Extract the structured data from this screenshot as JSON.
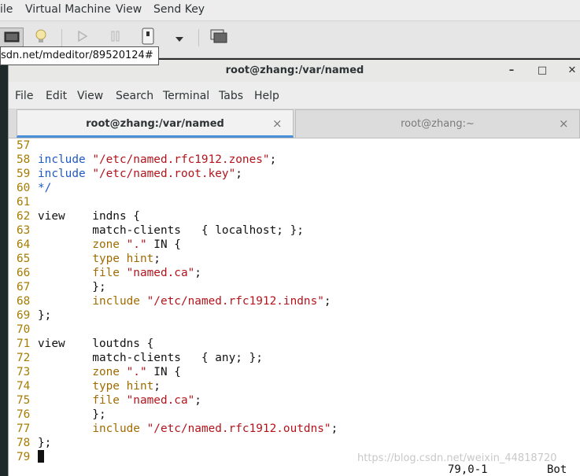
{
  "vm_menu": [
    "ile",
    "Virtual Machine",
    "View",
    "Send Key"
  ],
  "toolbar_icons": [
    "console-icon",
    "lightbulb-icon",
    "play-icon",
    "pause-icon",
    "power-icon",
    "dropdown-arrow-icon",
    "screenshot-icon"
  ],
  "tooltip_url": "sdn.net/mdeditor/89520124#",
  "window": {
    "title": "root@zhang:/var/named",
    "minimize": "–",
    "maximize": "□",
    "close": "✕"
  },
  "terminal_menu": [
    "File",
    "Edit",
    "View",
    "Search",
    "Terminal",
    "Tabs",
    "Help"
  ],
  "tabs": [
    {
      "label": "root@zhang:/var/named",
      "close": "×"
    },
    {
      "label": "root@zhang:~",
      "close": "×"
    }
  ],
  "code_lines": [
    {
      "n": "57",
      "parts": []
    },
    {
      "n": "58",
      "parts": [
        [
          "kw",
          "include "
        ],
        [
          "st",
          "\"/etc/named.rfc1912.zones\""
        ],
        [
          "",
          ""
        ],
        [
          "",
          ";"
        ]
      ]
    },
    {
      "n": "59",
      "parts": [
        [
          "kw",
          "include "
        ],
        [
          "st",
          "\"/etc/named.root.key\""
        ],
        [
          "",
          ";"
        ]
      ]
    },
    {
      "n": "60",
      "parts": [
        [
          "cm",
          "*/"
        ]
      ]
    },
    {
      "n": "61",
      "parts": []
    },
    {
      "n": "62",
      "parts": [
        [
          "",
          "view    indns {"
        ]
      ]
    },
    {
      "n": "63",
      "parts": [
        [
          "",
          "        match-clients   { localhost; };"
        ]
      ]
    },
    {
      "n": "64",
      "parts": [
        [
          "",
          "        "
        ],
        [
          "ty",
          "zone"
        ],
        [
          "",
          ""
        ],
        [
          "st",
          " \".\""
        ],
        [
          "",
          " IN {"
        ]
      ]
    },
    {
      "n": "65",
      "parts": [
        [
          "",
          "        "
        ],
        [
          "ty",
          "type"
        ],
        [
          "",
          ""
        ],
        [
          "ty",
          " hint"
        ],
        [
          "",
          ";"
        ]
      ]
    },
    {
      "n": "66",
      "parts": [
        [
          "",
          "        "
        ],
        [
          "ty",
          "file"
        ],
        [
          "st",
          " \"named.ca\""
        ],
        [
          "",
          ";"
        ]
      ]
    },
    {
      "n": "67",
      "parts": [
        [
          "",
          "        };"
        ]
      ]
    },
    {
      "n": "68",
      "parts": [
        [
          "",
          "        "
        ],
        [
          "ty",
          "include"
        ],
        [
          "st",
          " \"/etc/named.rfc1912.indns\""
        ],
        [
          "",
          ";"
        ]
      ]
    },
    {
      "n": "69",
      "parts": [
        [
          "",
          "};"
        ]
      ]
    },
    {
      "n": "70",
      "parts": []
    },
    {
      "n": "71",
      "parts": [
        [
          "",
          "view    loutdns {"
        ]
      ]
    },
    {
      "n": "72",
      "parts": [
        [
          "",
          "        match-clients   { any; };"
        ]
      ]
    },
    {
      "n": "73",
      "parts": [
        [
          "",
          "        "
        ],
        [
          "ty",
          "zone"
        ],
        [
          "st",
          " \".\""
        ],
        [
          "",
          " IN {"
        ]
      ]
    },
    {
      "n": "74",
      "parts": [
        [
          "",
          "        "
        ],
        [
          "ty",
          "type"
        ],
        [
          "ty",
          " hint"
        ],
        [
          "",
          ";"
        ]
      ]
    },
    {
      "n": "75",
      "parts": [
        [
          "",
          "        "
        ],
        [
          "ty",
          "file"
        ],
        [
          "st",
          " \"named.ca\""
        ],
        [
          "",
          ";"
        ]
      ]
    },
    {
      "n": "76",
      "parts": [
        [
          "",
          "        };"
        ]
      ]
    },
    {
      "n": "77",
      "parts": [
        [
          "",
          "        "
        ],
        [
          "ty",
          "include"
        ],
        [
          "st",
          " \"/etc/named.rfc1912.outdns\""
        ],
        [
          "",
          ";"
        ]
      ]
    },
    {
      "n": "78",
      "parts": [
        [
          "",
          "};"
        ]
      ]
    },
    {
      "n": "79",
      "parts": [
        [
          "cursor",
          ""
        ]
      ]
    }
  ],
  "status": {
    "position": "79,0-1",
    "scroll": "Bot"
  },
  "watermark": "https://blog.csdn.net/weixin_44818720"
}
